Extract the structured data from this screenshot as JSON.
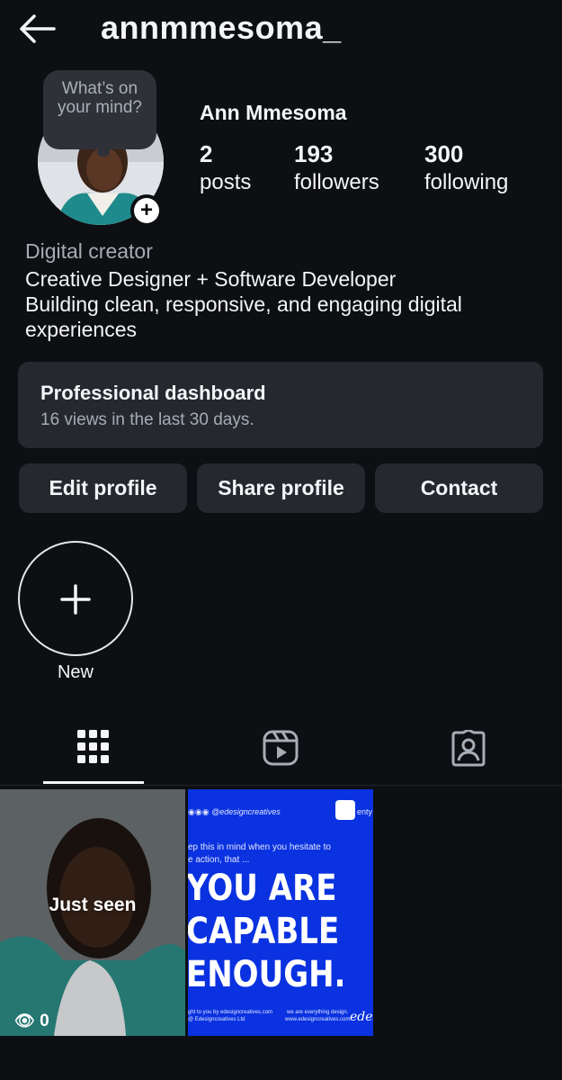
{
  "header": {
    "username": "annmmesoma_",
    "back_icon": "arrow-left-icon"
  },
  "profile": {
    "story_bubble": "What’s on your mind?",
    "display_name": "Ann Mmesoma",
    "stats": [
      {
        "value": "2",
        "label": "posts"
      },
      {
        "value": "193",
        "label": "followers"
      },
      {
        "value": "300",
        "label": "following"
      }
    ],
    "category": "Digital creator",
    "bio_line1": "Creative Designer + Software Developer",
    "bio_line2": "Building clean, responsive, and engaging digital experiences"
  },
  "dashboard": {
    "title": "Professional dashboard",
    "subtitle": "16 views in the last 30 days."
  },
  "buttons": {
    "edit": "Edit profile",
    "share": "Share profile",
    "contact": "Contact"
  },
  "highlights": {
    "new_label": "New"
  },
  "tabs": [
    {
      "name": "grid",
      "icon": "grid-icon",
      "active": true
    },
    {
      "name": "reels",
      "icon": "reels-icon",
      "active": false
    },
    {
      "name": "tagged",
      "icon": "tagged-icon",
      "active": false
    }
  ],
  "posts": [
    {
      "overlay": "Just seen",
      "views": "0"
    },
    {
      "handle": "@edesigncreatives",
      "corner_text": "enty",
      "intro_line1": "ep this in mind when you hesitate to",
      "intro_line2": "e action, that ...",
      "headline1": "YOU ARE",
      "headline2": "CAPABLE",
      "headline3": "ENOUGH.",
      "footer_left1": "ght to you by edesigncreatives.com",
      "footer_left2": "@ Edesigncreatives Ltd",
      "footer_right1": "we are everything design.",
      "footer_right2": "www.edesigncreatives.com",
      "brand": "edesi"
    }
  ],
  "colors": {
    "background": "#0d0f12",
    "card": "#25292f",
    "post_blue": "#0a32e0"
  }
}
